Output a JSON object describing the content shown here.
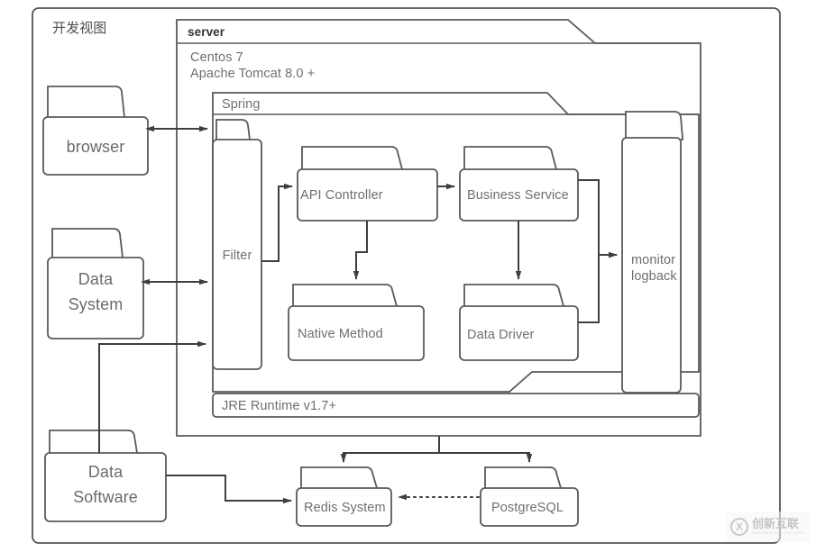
{
  "diagram": {
    "title": "开发视图",
    "type": "deployment-architecture-diagram"
  },
  "containers": {
    "server": {
      "label": "server",
      "lines": [
        "Centos 7",
        "Apache Tomcat 8.0 +"
      ]
    },
    "spring": {
      "label": "Spring"
    },
    "jre": {
      "label": "JRE Runtime v1.7+"
    }
  },
  "nodes": {
    "browser": {
      "label": "browser"
    },
    "data_system": {
      "label": "Data\nSystem",
      "line1": "Data",
      "line2": "System"
    },
    "data_software": {
      "label": "Data\nSoftware",
      "line1": "Data",
      "line2": "Software"
    },
    "filter": {
      "label": "Filter"
    },
    "api_controller": {
      "label": "API Controller"
    },
    "business_service": {
      "label": "Business Service"
    },
    "native_method": {
      "label": "Native Method"
    },
    "data_driver": {
      "label": "Data Driver"
    },
    "monitor": {
      "label": "monitor\nlogback",
      "line1": "monitor",
      "line2": "logback"
    },
    "redis": {
      "label": "Redis System"
    },
    "postgres": {
      "label": "PostgreSQL"
    }
  },
  "edges": [
    {
      "from": "browser",
      "to": "filter",
      "style": "solid",
      "arrows": "both"
    },
    {
      "from": "data_system",
      "to": "filter",
      "style": "solid",
      "arrows": "both"
    },
    {
      "from": "data_software",
      "to": "filter",
      "style": "solid",
      "arrows": "end"
    },
    {
      "from": "filter",
      "to": "api_controller",
      "style": "solid",
      "arrows": "end"
    },
    {
      "from": "api_controller",
      "to": "business_service",
      "style": "solid",
      "arrows": "end"
    },
    {
      "from": "api_controller",
      "to": "native_method",
      "style": "solid",
      "arrows": "end"
    },
    {
      "from": "business_service",
      "to": "data_driver",
      "style": "solid",
      "arrows": "end"
    },
    {
      "from": "business_service",
      "to": "monitor",
      "style": "solid",
      "arrows": "end"
    },
    {
      "from": "data_driver",
      "to": "monitor",
      "style": "solid",
      "arrows": "end"
    },
    {
      "from": "data_software",
      "to": "redis",
      "style": "solid",
      "arrows": "end"
    },
    {
      "from": "server",
      "to": "redis",
      "style": "solid",
      "arrows": "end"
    },
    {
      "from": "server",
      "to": "postgres",
      "style": "solid",
      "arrows": "end"
    },
    {
      "from": "postgres",
      "to": "redis",
      "style": "dotted",
      "arrows": "end"
    }
  ],
  "colors": {
    "stroke": "#4a4a4a",
    "frame_stroke": "#555555",
    "text": "#6f6f6f",
    "background": "#ffffff",
    "watermark": "#c8c8c8"
  },
  "watermark": {
    "mark": "X",
    "main": "创新互联",
    "sub": "CHUANG XIN HU LIAN"
  }
}
